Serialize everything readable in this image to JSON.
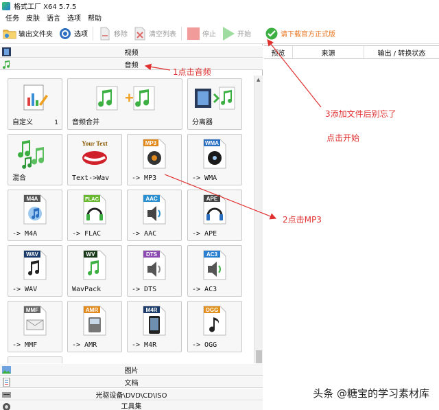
{
  "window": {
    "title": "格式工厂 X64 5.7.5"
  },
  "menu": [
    "任务",
    "皮肤",
    "语言",
    "选项",
    "帮助"
  ],
  "toolbar": {
    "output_folder": "输出文件夹",
    "options": "选项",
    "remove": "移除",
    "clear_list": "清空列表",
    "stop": "停止",
    "start": "开始",
    "download": "请下载官方正式版"
  },
  "categories": {
    "video": "视频",
    "audio": "音频",
    "picture": "图片",
    "document": "文档",
    "disc": "光驱设备\\DVD\\CD\\ISO",
    "toolbox": "工具集"
  },
  "tiles": {
    "custom": {
      "label": "自定义",
      "count": "1"
    },
    "audio_merge": {
      "label": "音频合并"
    },
    "separator": {
      "label": "分离器"
    },
    "mix": {
      "label": "混合"
    },
    "text_wav": {
      "label": "Text->Wav",
      "badge": "Your Text"
    },
    "mp3": {
      "label": "-> MP3",
      "badge": "MP3"
    },
    "wma": {
      "label": "-> WMA",
      "badge": "WMA"
    },
    "m4a": {
      "label": "-> M4A",
      "badge": "M4A"
    },
    "flac": {
      "label": "-> FLAC",
      "badge": "FLAC"
    },
    "aac": {
      "label": "-> AAC",
      "badge": "AAC"
    },
    "ape": {
      "label": "-> APE",
      "badge": "APE"
    },
    "wav": {
      "label": "-> WAV",
      "badge": "WAV"
    },
    "wavpack": {
      "label": "WavPack",
      "badge": "WV"
    },
    "dts": {
      "label": "-> DTS",
      "badge": "DTS"
    },
    "ac3": {
      "label": "-> AC3",
      "badge": "AC3"
    },
    "mmf": {
      "label": "-> MMF",
      "badge": "MMF"
    },
    "amr": {
      "label": "-> AMR",
      "badge": "AMR"
    },
    "m4r": {
      "label": "-> M4R",
      "badge": "M4R"
    },
    "ogg": {
      "label": "-> OGG",
      "badge": "OGG"
    }
  },
  "task_list": {
    "col_preview": "预览",
    "col_source": "来源",
    "col_output": "输出 / 转换状态"
  },
  "annotations": {
    "step1": "1点击音频",
    "step2": "2点击MP3",
    "step3": "3添加文件后别忘了",
    "step3b": "点击开始"
  },
  "watermark": "头条 @糖宝的学习素材库",
  "colors": {
    "accent_red": "#e03030",
    "download_orange": "#e8731c",
    "music_green": "#3cb043"
  }
}
